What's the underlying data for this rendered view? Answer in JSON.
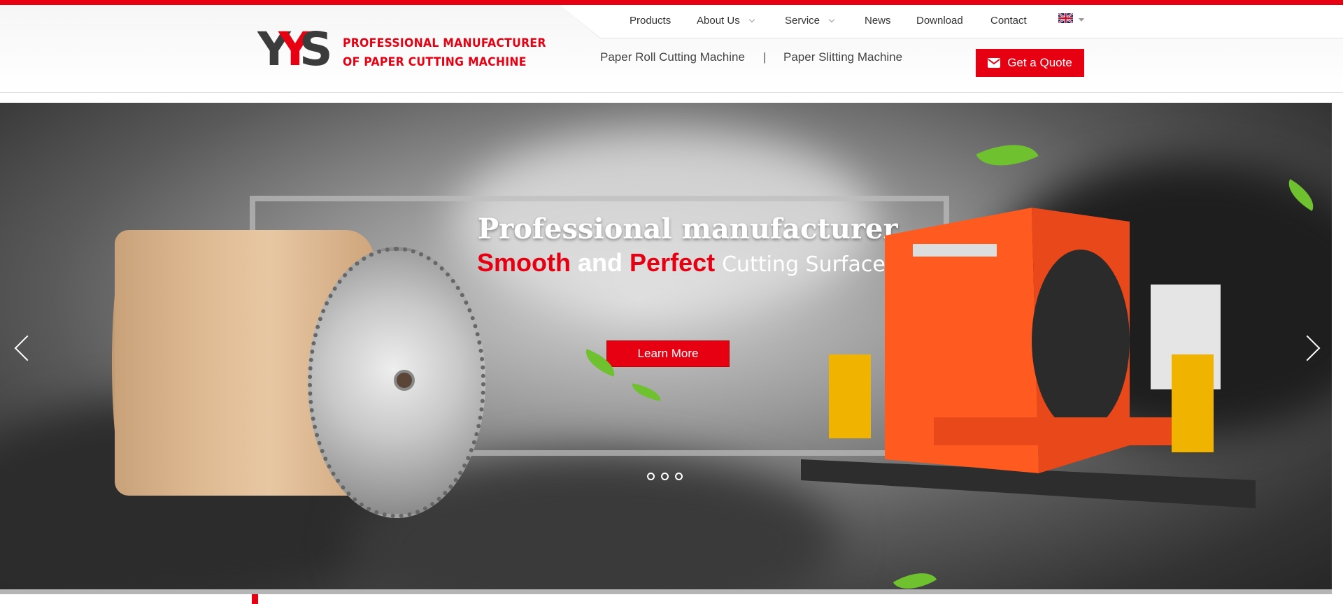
{
  "logo": {
    "mark_text": "YYS",
    "tagline_1": "PROFESSIONAL MANUFACTURER",
    "tagline_2": "OF PAPER CUTTING MACHINE"
  },
  "nav": {
    "items": [
      {
        "label": "Products",
        "dropdown": false
      },
      {
        "label": "About Us",
        "dropdown": true
      },
      {
        "label": "Service",
        "dropdown": true
      },
      {
        "label": "News",
        "dropdown": false
      },
      {
        "label": "Download",
        "dropdown": false
      },
      {
        "label": "Contact",
        "dropdown": false
      }
    ],
    "language_icon": "uk-flag-icon"
  },
  "subnav": {
    "link_1": "Paper Roll Cutting Machine",
    "separator": "|",
    "link_2": "Paper Slitting Machine"
  },
  "quote_button": {
    "label": "Get a Quote",
    "icon": "envelope-icon"
  },
  "hero": {
    "title": "Professional manufacturer",
    "sub_red_1": "Smooth",
    "sub_white": "and",
    "sub_red_2": "Perfect",
    "sub_thin": "Cutting Surface",
    "cta": "Learn More",
    "slides": 3
  },
  "colors": {
    "brand_red": "#e60012"
  }
}
